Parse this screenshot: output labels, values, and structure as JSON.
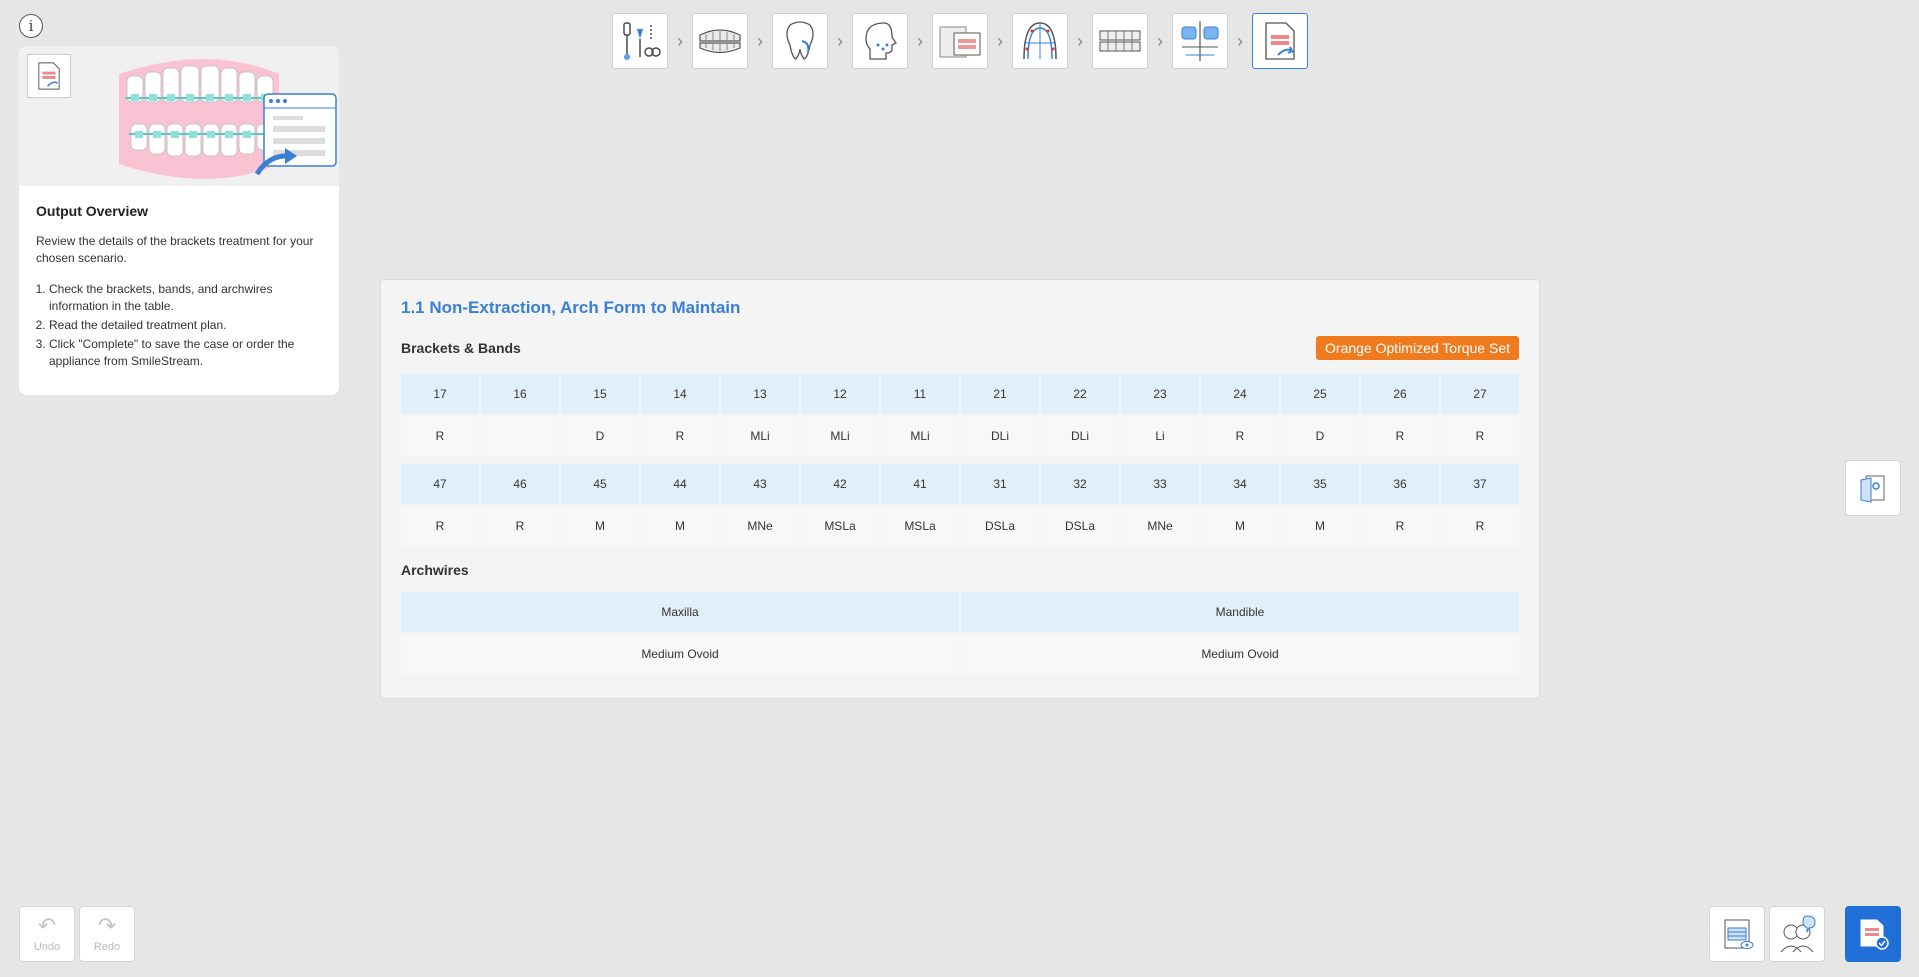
{
  "info_label": "i",
  "steps": [
    {
      "icon": "instruments-icon"
    },
    {
      "icon": "dental-arch-icon"
    },
    {
      "icon": "tooth-icon"
    },
    {
      "icon": "head-profile-icon"
    },
    {
      "icon": "xray-icon"
    },
    {
      "icon": "arch-form-icon"
    },
    {
      "icon": "teeth-side-icon"
    },
    {
      "icon": "bracket-align-icon"
    },
    {
      "icon": "output-document-icon",
      "active": true
    }
  ],
  "left_panel": {
    "title": "Output Overview",
    "description": "Review the details of the brackets treatment for your chosen scenario.",
    "steps": [
      "Check the brackets, bands, and archwires information in the table.",
      "Read the detailed treatment plan.",
      "Click \"Complete\" to save the case or order the appliance from SmileStream."
    ]
  },
  "main": {
    "scenario_title": "1.1 Non-Extraction, Arch Form to Maintain",
    "brackets_title": "Brackets & Bands",
    "torque_set": "Orange Optimized Torque Set",
    "upper_teeth": [
      "17",
      "16",
      "15",
      "14",
      "13",
      "12",
      "11",
      "21",
      "22",
      "23",
      "24",
      "25",
      "26",
      "27"
    ],
    "upper_values": [
      "R",
      "",
      "D",
      "R",
      "MLi",
      "MLi",
      "MLi",
      "DLi",
      "DLi",
      "Li",
      "R",
      "D",
      "R",
      "R"
    ],
    "lower_teeth": [
      "47",
      "46",
      "45",
      "44",
      "43",
      "42",
      "41",
      "31",
      "32",
      "33",
      "34",
      "35",
      "36",
      "37"
    ],
    "lower_values": [
      "R",
      "R",
      "M",
      "M",
      "MNe",
      "MSLa",
      "MSLa",
      "DSLa",
      "DSLa",
      "MNe",
      "M",
      "M",
      "R",
      "R"
    ],
    "archwires_title": "Archwires",
    "archwires": {
      "headers": [
        "Maxilla",
        "Mandible"
      ],
      "values": [
        "Medium Ovoid",
        "Medium Ovoid"
      ]
    }
  },
  "undo_label": "Undo",
  "redo_label": "Redo",
  "colors": {
    "accent": "#3a7fd6",
    "badge": "#f07a1e",
    "header_cell": "#e1effb",
    "primary_button": "#1f6fd6"
  }
}
